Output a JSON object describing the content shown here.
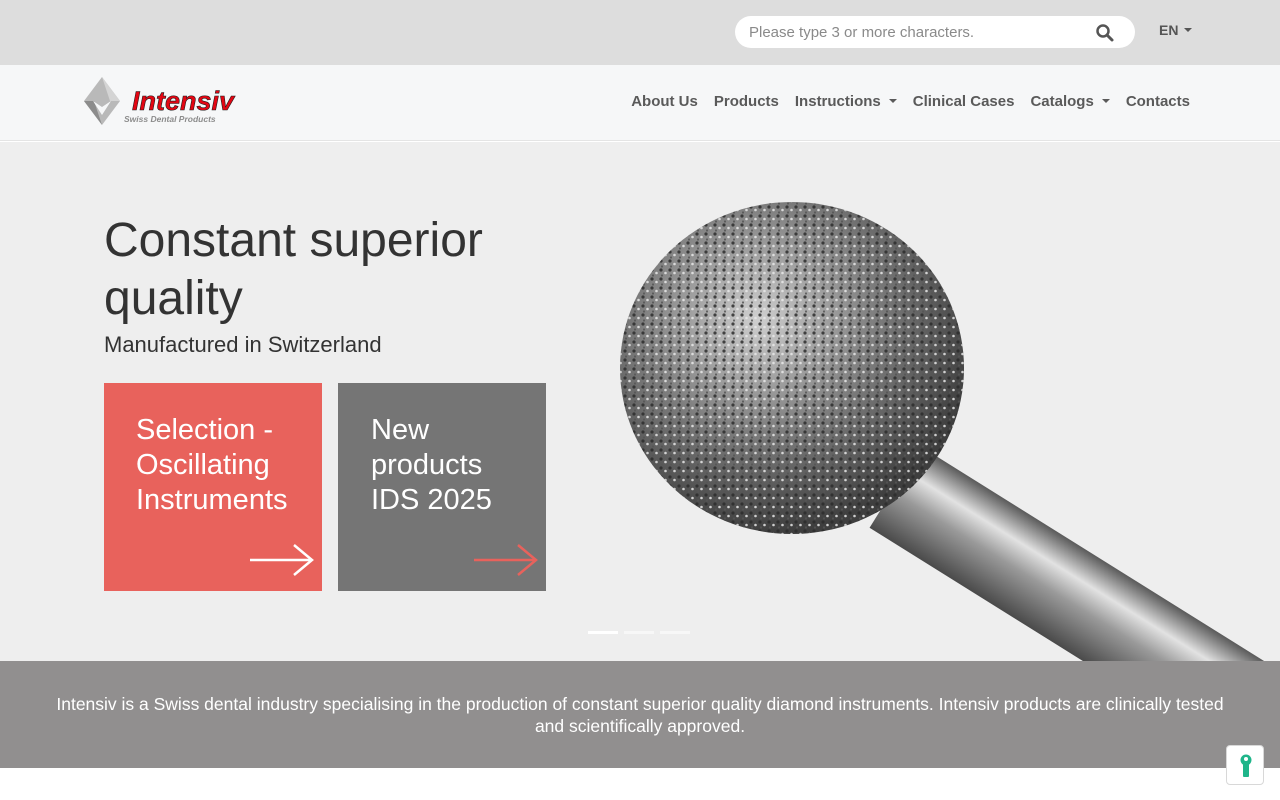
{
  "topbar": {
    "search_placeholder": "Please type 3 or more characters.",
    "language": "EN",
    "icons": {
      "search": "search-icon",
      "language_caret": "caret-down-icon"
    }
  },
  "header": {
    "logo_text": "Intensiv",
    "logo_tagline": "Swiss Dental Products",
    "nav": {
      "about": "About Us",
      "products": "Products",
      "instructions": "Instructions",
      "clinical_cases": "Clinical Cases",
      "catalogs": "Catalogs",
      "contacts": "Contacts"
    }
  },
  "hero": {
    "title": "Constant superior quality",
    "subtitle": "Manufactured in Switzerland",
    "cards": [
      {
        "label": "Selection - Oscillating Instruments",
        "color": "#e8625c",
        "arrow_color": "#ffffff"
      },
      {
        "label": "New products IDS 2025",
        "color": "#757575",
        "arrow_color": "#e8625c"
      }
    ],
    "carousel_active_index": 0,
    "carousel_count": 3
  },
  "about": {
    "text": "Intensiv is a Swiss dental industry specialising in the production of constant superior quality diamond instruments. Intensiv products are clinically tested and scientifically approved."
  },
  "colors": {
    "brand_red": "#e30613",
    "accent_red": "#e8625c",
    "band_grey": "#918f8f",
    "helper_green": "#1fb58a"
  }
}
